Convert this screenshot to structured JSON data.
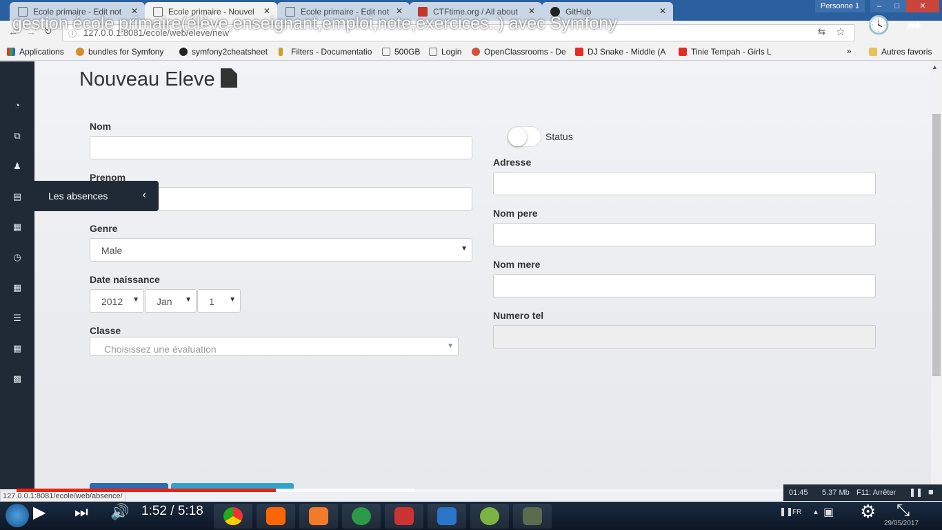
{
  "browser": {
    "tabs": [
      {
        "label": "Ecole primaire - Edit not"
      },
      {
        "label": "Ecole primaire - Nouvel"
      },
      {
        "label": "Ecole primaire - Edit not"
      },
      {
        "label": "CTFtime.org / All about"
      },
      {
        "label": "GitHub"
      }
    ],
    "profile": "Personne 1",
    "url": "127.0.0.1:8081/ecole/web/eleve/new",
    "bookmarks": [
      "Applications",
      "bundles for Symfony",
      "symfony2cheatsheet",
      "Filters - Documentatio",
      "500GB",
      "Login",
      "OpenClassrooms - De",
      "DJ Snake - Middle (A",
      "Tinie Tempah - Girls L"
    ],
    "more": "»",
    "other_bookmarks": "Autres favoris",
    "status_url": "127.0.0.1:8081/ecole/web/absence/"
  },
  "video": {
    "title": "gestion école primaire(élève,enseignant,emploi,note,exercices..) avec Symfony",
    "timecode": "1:52 / 5:18",
    "played_fraction": 0.338,
    "buffered_fraction": 0.52
  },
  "sidebar": {
    "icons": [
      "dashboard-icon",
      "copy-icon",
      "student-icon",
      "absences-icon",
      "calendar-icon",
      "clock-icon",
      "schedule-icon",
      "list-icon",
      "agenda-icon",
      "grid-icon"
    ],
    "flyout_label": "Les absences"
  },
  "form": {
    "title": "Nouveau Eleve",
    "nom_label": "Nom",
    "prenom_label": "Prenom",
    "genre_label": "Genre",
    "genre_value": "Male",
    "date_label": "Date naissance",
    "year": "2012",
    "month": "Jan",
    "day": "1",
    "classe_label": "Classe",
    "classe_placeholder": "Choisissez une évaluation",
    "status_label": "Status",
    "adresse_label": "Adresse",
    "nom_pere_label": "Nom pere",
    "nom_mere_label": "Nom mere",
    "numero_tel_label": "Numero tel"
  },
  "perf": {
    "time": "01:45",
    "size": "5.37 Mb",
    "hotkey": "F11: Arrêter"
  },
  "taskbar": {
    "lang": "FR",
    "date": "29/05/2017"
  }
}
